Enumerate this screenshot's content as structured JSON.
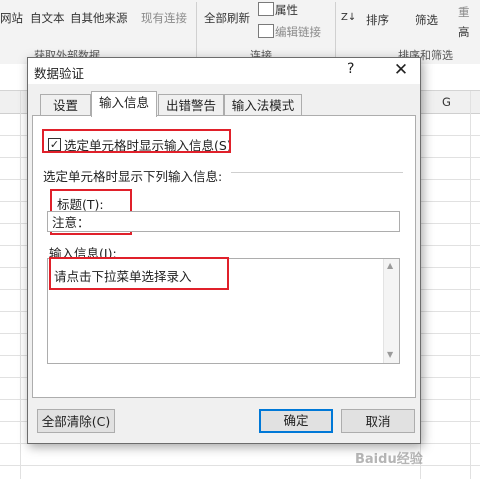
{
  "ribbon": {
    "website": "网站",
    "from_text": "自文本",
    "other_sources": "自其他来源",
    "existing_connections": "现有连接",
    "refresh_all": "全部刷新",
    "properties": "属性",
    "edit_links": "编辑链接",
    "sort": "排序",
    "filter": "筛选",
    "reapply_partial": "重",
    "advanced_partial": "高",
    "group_get_external": "获取外部数据",
    "group_connections": "连接",
    "group_sort_filter": "排序和筛选",
    "column_g": "G"
  },
  "dialog": {
    "title": "数据验证",
    "help": "?",
    "close": "✕",
    "tabs": [
      "设置",
      "输入信息",
      "出错警告",
      "输入法模式"
    ],
    "active_tab": "输入信息",
    "show_input_checkbox_label": "选定单元格时显示输入信息(S)",
    "show_input_checked": true,
    "section_label": "选定单元格时显示下列输入信息:",
    "title_label": "标题(T):",
    "title_value": "注意：",
    "message_label": "输入信息(I):",
    "message_value": "请点击下拉菜单选择录入",
    "clear_all_button": "全部清除(C)",
    "ok_button": "确定",
    "cancel_button": "取消"
  },
  "watermark": "Baidu经验",
  "colors": {
    "highlight_red": "#e0202a",
    "primary_blue": "#0078d7"
  }
}
